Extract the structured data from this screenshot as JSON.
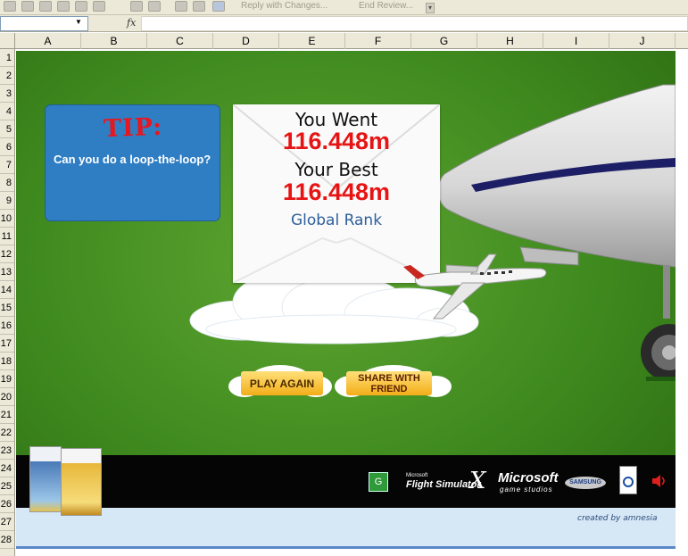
{
  "excel": {
    "toolbar": {
      "reply_label": "Reply with Changes...",
      "end_review_label": "End Review..."
    },
    "formula_bar": {
      "fx_label": "fx"
    },
    "columns": [
      "A",
      "B",
      "C",
      "D",
      "E",
      "F",
      "G",
      "H",
      "I",
      "J"
    ],
    "rows": [
      "1",
      "2",
      "3",
      "4",
      "5",
      "6",
      "7",
      "8",
      "9",
      "10",
      "11",
      "12",
      "13",
      "14",
      "15",
      "16",
      "17",
      "18",
      "19",
      "20",
      "21",
      "22",
      "23",
      "24",
      "25",
      "26",
      "27",
      "28"
    ]
  },
  "game": {
    "tip": {
      "title": "TIP:",
      "text": "Can you do a loop-the-loop?"
    },
    "results": {
      "went_label": "You Went",
      "went_value": "116.448m",
      "best_label": "Your Best",
      "best_value": "116.448m",
      "rank_label": "Global Rank"
    },
    "buttons": {
      "play_again": "PLAY AGAIN",
      "share": "SHARE WITH FRIEND"
    },
    "footer": {
      "fsx_logo_small": "Microsoft",
      "fsx_logo": "Flight Simulator",
      "fsx_x": "X",
      "ms_logo": "Microsoft",
      "game_studios": "game studios",
      "samsung": "SAMSUNG",
      "credit": "created by amnesia"
    },
    "colors": {
      "grass": "#3f8a1f",
      "tip_blue": "#2f7ec4",
      "value_red": "#e61414",
      "rank_blue": "#2e5f9b",
      "button_gold": "#f3ad18"
    }
  }
}
